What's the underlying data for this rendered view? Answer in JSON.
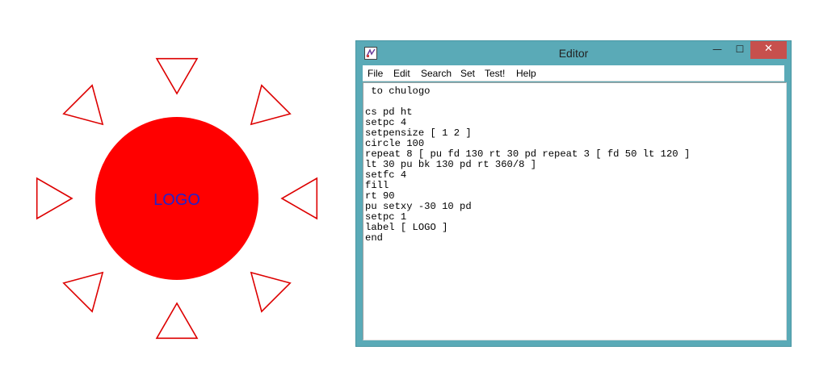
{
  "drawing": {
    "label_text": "LOGO",
    "circle_color": "#ff0000",
    "triangle_color": "#dd0000",
    "label_color": "#2222cc"
  },
  "editor": {
    "title": "Editor",
    "window_buttons": {
      "minimize": "—",
      "maximize": "☐",
      "close": "✕"
    },
    "menu": [
      "File",
      "Edit",
      "Search",
      "Set",
      "Test!",
      "Help"
    ],
    "code_lines": [
      " to chulogo",
      "",
      "cs pd ht",
      "setpc 4",
      "setpensize [ 1 2 ]",
      "circle 100",
      "repeat 8 [ pu fd 130 rt 30 pd repeat 3 [ fd 50 lt 120 ]",
      "lt 30 pu bk 130 pd rt 360/8 ]",
      "setfc 4",
      "fill",
      "rt 90",
      "pu setxy -30 10 pd",
      "setpc 1",
      "label [ LOGO ]",
      "end"
    ]
  }
}
